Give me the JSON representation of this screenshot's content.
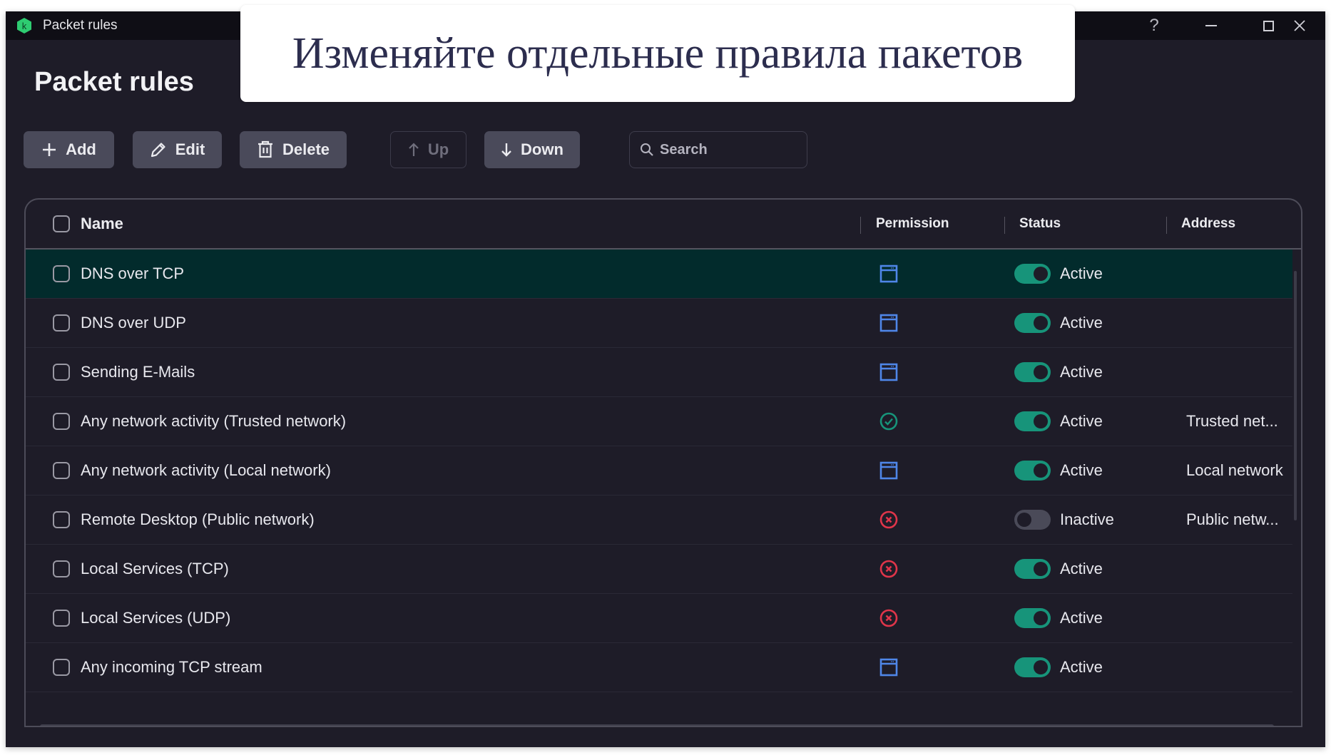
{
  "window": {
    "title": "Packet rules",
    "controls": {
      "help": "?",
      "minimize": "—",
      "maximize": "☐",
      "close": "✕"
    }
  },
  "page": {
    "title": "Packet rules"
  },
  "toolbar": {
    "add_label": "Add",
    "edit_label": "Edit",
    "delete_label": "Delete",
    "up_label": "Up",
    "down_label": "Down",
    "search_placeholder": "Search",
    "search_value": ""
  },
  "table": {
    "columns": {
      "name": "Name",
      "permission": "Permission",
      "status": "Status",
      "address": "Address"
    },
    "rows": [
      {
        "name": "DNS over TCP",
        "permission": "application-icon",
        "status": "Active",
        "enabled": true,
        "address": "",
        "selected": true
      },
      {
        "name": "DNS over UDP",
        "permission": "application-icon",
        "status": "Active",
        "enabled": true,
        "address": ""
      },
      {
        "name": "Sending E-Mails",
        "permission": "application-icon",
        "status": "Active",
        "enabled": true,
        "address": ""
      },
      {
        "name": "Any network activity (Trusted network)",
        "permission": "allow-icon",
        "status": "Active",
        "enabled": true,
        "address": "Trusted net..."
      },
      {
        "name": "Any network activity (Local network)",
        "permission": "application-icon",
        "status": "Active",
        "enabled": true,
        "address": "Local network"
      },
      {
        "name": "Remote Desktop (Public network)",
        "permission": "block-icon",
        "status": "Inactive",
        "enabled": false,
        "address": "Public netw..."
      },
      {
        "name": "Local Services (TCP)",
        "permission": "block-icon",
        "status": "Active",
        "enabled": true,
        "address": ""
      },
      {
        "name": "Local Services (UDP)",
        "permission": "block-icon",
        "status": "Active",
        "enabled": true,
        "address": ""
      },
      {
        "name": "Any incoming TCP stream",
        "permission": "application-icon",
        "status": "Active",
        "enabled": true,
        "address": ""
      }
    ]
  },
  "banner": {
    "text": "Изменяйте отдельные правила пакетов"
  },
  "colors": {
    "accent_green": "#17947a",
    "app_blue": "#4f86e8",
    "allow_green": "#17947a",
    "block_red": "#e0354a",
    "selected_row": "#022b2c"
  }
}
